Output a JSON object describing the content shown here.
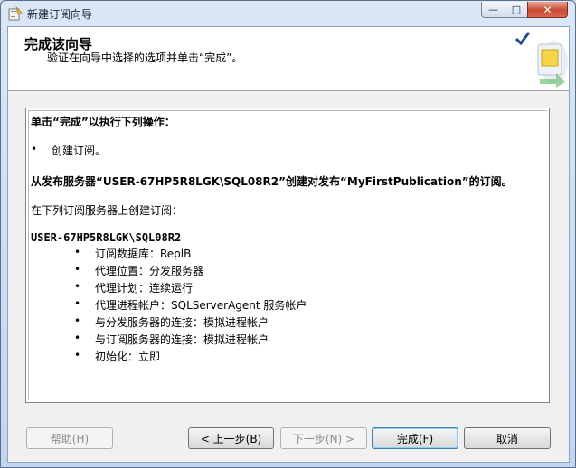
{
  "window": {
    "title": "新建订阅向导"
  },
  "header": {
    "title": "完成该向导",
    "subtitle": "验证在向导中选择的选项并单击“完成”。"
  },
  "summary": {
    "lead": "单击“完成”以执行下列操作：",
    "actions": [
      "创建订阅。"
    ],
    "from_line": "从发布服务器“USER-67HP5R8LGK\\SQL08R2”创建对发布“MyFirstPublication”的订阅。",
    "subscriber_intro": "在下列订阅服务器上创建订阅：",
    "subscriber_name": "USER-67HP5R8LGK\\SQL08R2",
    "details": [
      "订阅数据库：ReplB",
      "代理位置：分发服务器",
      "代理计划：连续运行",
      "代理进程帐户：SQLServerAgent 服务帐户",
      "与分发服务器的连接：模拟进程帐户",
      "与订阅服务器的连接：模拟进程帐户",
      "初始化：立即"
    ]
  },
  "buttons": {
    "help": "帮助(H)",
    "back": "< 上一步(B)",
    "next": "下一步(N) >",
    "finish": "完成(F)",
    "cancel": "取消"
  },
  "controls": {
    "minimize": "—",
    "maximize": "□",
    "close": "✕"
  }
}
